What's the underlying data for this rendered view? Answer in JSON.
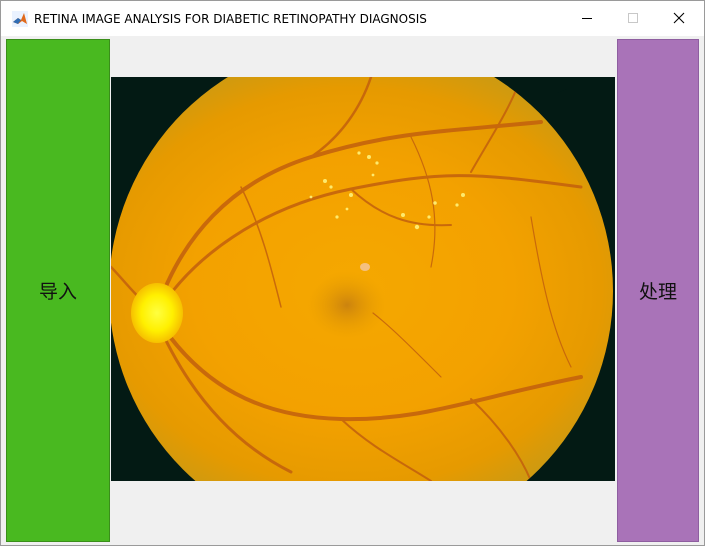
{
  "window": {
    "title": "RETINA IMAGE ANALYSIS FOR DIABETIC RETINOPATHY DIAGNOSIS",
    "app_icon": "matlab-icon",
    "controls": {
      "minimize_icon": "minimize-icon",
      "maximize_icon": "maximize-icon",
      "close_icon": "close-icon"
    }
  },
  "buttons": {
    "import_label": "导入",
    "process_label": "处理"
  },
  "colors": {
    "import_button": "#49b920",
    "process_button": "#a973b8",
    "fundus_background": "#031a14",
    "fundus_main": "#f0a400",
    "optic_disc": "#ffee00"
  },
  "image": {
    "content": "retinal-fundus-photograph"
  }
}
